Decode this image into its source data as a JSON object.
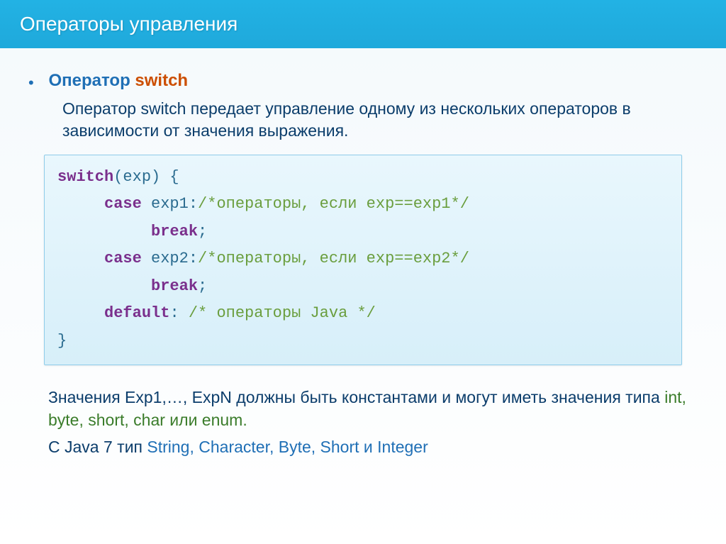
{
  "slide": {
    "title": "Операторы управления",
    "operator_name": "Оператор ",
    "operator_keyword": "switch",
    "description": "Оператор switch передает управление одному из нескольких операторов в зависимости от  значения выражения.",
    "code": {
      "kw_switch": "switch",
      "p1": "(exp) {",
      "pad1": "     ",
      "kw_case1": "case",
      "ce1": " exp1:",
      "cmt1": "/*операторы, если exp==exp1*/",
      "pad2": "          ",
      "kw_break1": "break",
      "semi1": ";",
      "kw_case2": "case",
      "ce2": " exp2:",
      "cmt2": "/*операторы, если exp==exp2*/",
      "kw_break2": "break",
      "semi2": ";",
      "kw_default": "default",
      "colon": ": ",
      "cmt3": "/* операторы Java */",
      "close": "}"
    },
    "note1_a": "Значения Exp1,…, ExpN должны быть константами и могут иметь значения типа ",
    "note1_b": "int, byte, short, char или enum.",
    "note2_a": "С Java 7 тип ",
    "note2_b": "String, Character, Byte, Short и Integer"
  }
}
